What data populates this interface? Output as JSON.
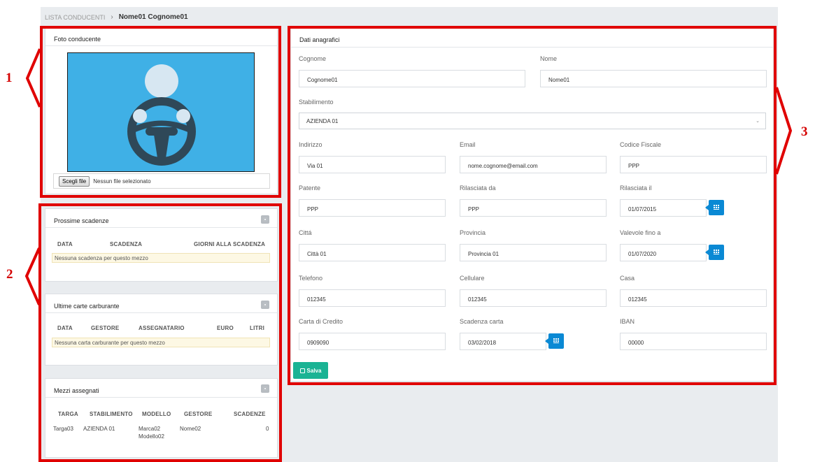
{
  "breadcrumb": {
    "parent": "LISTA CONDUCENTI",
    "separator": "›",
    "current": "Nome01 Cognome01"
  },
  "photo_panel": {
    "title": "Foto conducente",
    "choose_file": "Scegli file",
    "no_file": "Nessun file selezionato",
    "placeholder_icon": "driver-steering-wheel-icon",
    "photo_bg": "#3fb0e6"
  },
  "deadlines": {
    "title": "Prossime scadenze",
    "columns": [
      "DATA",
      "SCADENZA",
      "GIORNI ALLA SCADENZA"
    ],
    "empty": "Nessuna scadenza per questo mezzo"
  },
  "fuel_cards": {
    "title": "Ultime carte carburante",
    "columns": [
      "DATA",
      "GESTORE",
      "ASSEGNATARIO",
      "EURO",
      "LITRI"
    ],
    "empty": "Nessuna carta carburante per questo mezzo"
  },
  "vehicles": {
    "title": "Mezzi assegnati",
    "columns": [
      "TARGA",
      "STABILIMENTO",
      "MODELLO",
      "GESTORE",
      "SCADENZE"
    ],
    "rows": [
      {
        "targa": "Targa03",
        "stabilimento": "AZIENDA 01",
        "modello_1": "Marca02",
        "modello_2": "Modello02",
        "gestore": "Nome02",
        "scadenze": "0"
      }
    ]
  },
  "personal": {
    "title": "Dati anagrafici",
    "cognome_label": "Cognome",
    "cognome": "Cognome01",
    "nome_label": "Nome",
    "nome": "Nome01",
    "stabilimento_label": "Stabilimento",
    "stabilimento": "AZIENDA 01",
    "indirizzo_label": "Indirizzo",
    "indirizzo": "Via 01",
    "email_label": "Email",
    "email": "nome.cognome@email.com",
    "cf_label": "Codice Fiscale",
    "cf": "PPP",
    "patente_label": "Patente",
    "patente": "PPP",
    "rilasciata_da_label": "Rilasciata da",
    "rilasciata_da": "PPP",
    "rilasciata_il_label": "Rilasciata il",
    "rilasciata_il": "01/07/2015",
    "citta_label": "Cittá",
    "citta": "Città 01",
    "provincia_label": "Provincia",
    "provincia": "Provincia 01",
    "valevole_label": "Valevole fino a",
    "valevole": "01/07/2020",
    "telefono_label": "Telefono",
    "telefono": "012345",
    "cellulare_label": "Cellulare",
    "cellulare": "012345",
    "casa_label": "Casa",
    "casa": "012345",
    "carta_label": "Carta di Credito",
    "carta": "0909090",
    "scadenza_carta_label": "Scadenza carta",
    "scadenza_carta": "03/02/2018",
    "iban_label": "IBAN",
    "iban": "00000",
    "save": "Salva"
  },
  "callouts": {
    "one": "1",
    "two": "2",
    "three": "3",
    "color": "#e00000"
  },
  "colors": {
    "accent_blue": "#0a89d4",
    "save_green": "#1ab394",
    "empty_row": "#fdf8e4"
  }
}
